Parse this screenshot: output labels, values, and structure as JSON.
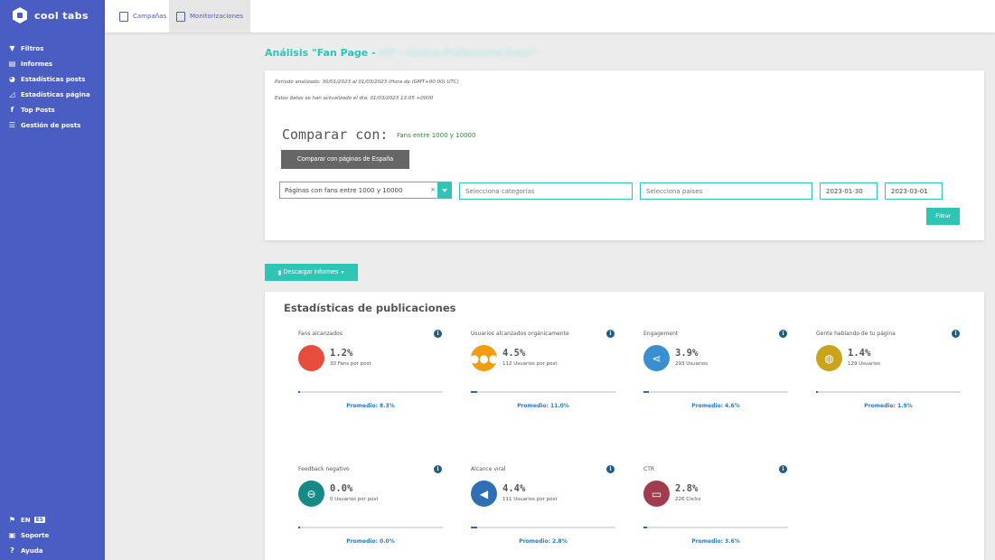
{
  "sidebar": {
    "logo": "cool tabs",
    "items": [
      {
        "label": "Filtros",
        "icon": "filter-icon",
        "glyph": "▼"
      },
      {
        "label": "Informes",
        "icon": "file-icon",
        "glyph": "▤"
      },
      {
        "label": "Estadísticas posts",
        "icon": "palette-icon",
        "glyph": "◕"
      },
      {
        "label": "Estadísticas página",
        "icon": "area-chart-icon",
        "glyph": "◿"
      },
      {
        "label": "Top Posts",
        "icon": "facebook-icon",
        "glyph": "f"
      },
      {
        "label": "Gestión de posts",
        "icon": "list-icon",
        "glyph": "☰"
      }
    ],
    "bottom": {
      "language": "EN",
      "language_flag": "ES",
      "support": "Soporte",
      "help": "Ayuda"
    }
  },
  "topbar": {
    "tabs": [
      {
        "label": "Campañas",
        "active": false
      },
      {
        "label": "Monitorizaciones",
        "active": true
      }
    ]
  },
  "page": {
    "title_prefix": "Análisis \"Fan Page - ",
    "title_blurred": "HIP - Horeca Professional Expo\""
  },
  "filters": {
    "period": "Periodo analizado: 30/01/2023 al 01/03/2023 (Hora de (GMT+00:00) UTC)",
    "updated": "Estos datos se han actualizado el día: 01/03/2023 13:05 +0000",
    "compare_title": "Comparar con:",
    "compare_value": "Fans entre 1000 y 10000",
    "compare_button": "Comparar con páginas de España",
    "select_value": "Páginas con fans entre 1000 y 10000",
    "select_clear": "×",
    "categories_placeholder": "Selecciona categorías",
    "countries_placeholder": "Selecciona países",
    "date_from": "2023-01-30",
    "date_to": "2023-03-01",
    "filter_button": "Filtrar"
  },
  "download_button": "Descargar informes",
  "stats": {
    "title": "Estadísticas de publicaciones",
    "items": [
      {
        "label": "Fans alcanzados",
        "value": "1.2%",
        "sub": "30 Fans por post",
        "avg": "Promedio: 8.3%",
        "color": "#e74c3c",
        "icon": "circle-icon",
        "glyph": "",
        "progress": 1.2
      },
      {
        "label": "Usuarios alcanzados orgánicamente",
        "value": "4.5%",
        "sub": "112 Usuarios por post",
        "avg": "Promedio: 11.0%",
        "color": "#f39c12",
        "icon": "users-icon",
        "glyph": "●●●",
        "progress": 4.5
      },
      {
        "label": "Engagement",
        "value": "3.9%",
        "sub": "293 Usuarios",
        "avg": "Promedio: 4.6%",
        "color": "#3a8fd0",
        "icon": "share-icon",
        "glyph": "⋖",
        "progress": 3.9
      },
      {
        "label": "Gente hablando de tu página",
        "value": "1.4%",
        "sub": "129 Usuarios",
        "avg": "Promedio: 1.9%",
        "color": "#c9a41a",
        "icon": "comments-icon",
        "glyph": "◍",
        "progress": 1.4
      },
      {
        "label": "Feedback negativo",
        "value": "0.0%",
        "sub": "0 Usuarios por post",
        "avg": "Promedio: 0.0%",
        "color": "#178a86",
        "icon": "minus-circle-icon",
        "glyph": "⊖",
        "progress": 0.0
      },
      {
        "label": "Alcance viral",
        "value": "4.4%",
        "sub": "111 Usuarios por post",
        "avg": "Promedio: 2.8%",
        "color": "#2f6fb5",
        "icon": "bullhorn-icon",
        "glyph": "◀",
        "progress": 4.4
      },
      {
        "label": "CTR",
        "value": "2.8%",
        "sub": "226 Clicks",
        "avg": "Promedio: 3.6%",
        "color": "#a13c4f",
        "icon": "monitor-icon",
        "glyph": "▭",
        "progress": 2.8
      }
    ]
  }
}
